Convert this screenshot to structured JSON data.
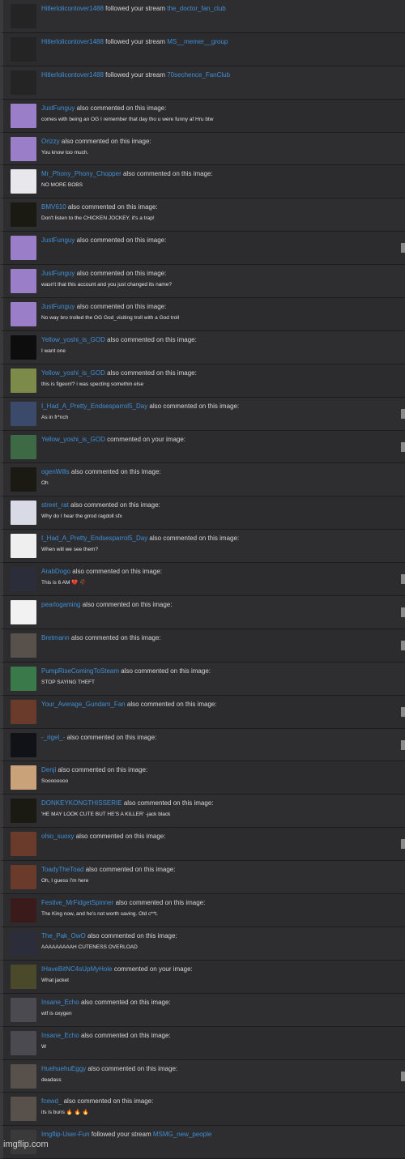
{
  "notifications": [
    {
      "user": "Hitlerlolicontover1488",
      "action": "followed your stream",
      "target": "the_doctor_fan_club",
      "message": "",
      "avatar": "#242424"
    },
    {
      "user": "Hitlerlolicontover1488",
      "action": "followed your stream",
      "target": "MS__memer__group",
      "message": "",
      "avatar": "#242424"
    },
    {
      "user": "Hitlerlolicontover1488",
      "action": "followed your stream",
      "target": "70sechence_FanClub",
      "message": "",
      "avatar": "#242424"
    },
    {
      "user": "JustFunguy",
      "action": "also commented on this image:",
      "target": "",
      "message": "comes with being an OG I remember that day tho u were funny af Hru btw",
      "avatar": "#9a7fc8"
    },
    {
      "user": "Orizzy",
      "action": "also commented on this image:",
      "target": "",
      "message": "You know too much.",
      "avatar": "#9a7fc8"
    },
    {
      "user": "Mr_Phony_Phony_Chopper",
      "action": "also commented on this image:",
      "target": "",
      "message": "NO MORE BOBS",
      "avatar": "#e8e8ec"
    },
    {
      "user": "BMV610",
      "action": "also commented on this image:",
      "target": "",
      "message": "Don't listen to the CHICKEN JOCKEY, it's a trap!",
      "avatar": "#1a1a12"
    },
    {
      "user": "JustFunguy",
      "action": "also commented on this image:",
      "target": "",
      "message": "",
      "avatar": "#9a7fc8"
    },
    {
      "user": "JustFunguy",
      "action": "also commented on this image:",
      "target": "",
      "message": "wasn't that this account and you just changed its name?",
      "avatar": "#9a7fc8"
    },
    {
      "user": "JustFunguy",
      "action": "also commented on this image:",
      "target": "",
      "message": "No way bro trolled the OG God_visiting troll with a God troll",
      "avatar": "#9a7fc8"
    },
    {
      "user": "Yellow_yoshi_is_GOD",
      "action": "also commented on this image:",
      "target": "",
      "message": "I want one",
      "avatar": "#0d0d0d"
    },
    {
      "user": "Yellow_yoshi_is_GOD",
      "action": "also commented on this image:",
      "target": "",
      "message": "this is figeon!? i was specting somethin else",
      "avatar": "#7c8a4a"
    },
    {
      "user": "I_Had_A_Pretty_Endsesparrol5_Day",
      "action": "also commented on this image:",
      "target": "",
      "message": "As in fr*nch",
      "avatar": "#3b4a6a"
    },
    {
      "user": "Yellow_yoshi_is_GOD",
      "action": "commented on your image:",
      "target": "",
      "message": "",
      "avatar": "#3d6a44"
    },
    {
      "user": "ogenWills",
      "action": "also commented on this image:",
      "target": "",
      "message": "Oh",
      "avatar": "#1a1a12"
    },
    {
      "user": "street_rat",
      "action": "also commented on this image:",
      "target": "",
      "message": "Why do I hear the grrod ragdoll sfx",
      "avatar": "#d8dbe6"
    },
    {
      "user": "I_Had_A_Pretty_Endsesparrol5_Day",
      "action": "also commented on this image:",
      "target": "",
      "message": "When will we see them?",
      "avatar": "#efefef"
    },
    {
      "user": "ArabDogo",
      "action": "also commented on this image:",
      "target": "",
      "message": "This is 6 AM 💔 🥀",
      "avatar": "#2b2d3a"
    },
    {
      "user": "pearlogaming",
      "action": "also commented on this image:",
      "target": "",
      "message": "",
      "avatar": "#f2f2f2"
    },
    {
      "user": "Bretmann",
      "action": "also commented on this image:",
      "target": "",
      "message": "",
      "avatar": "#58504a"
    },
    {
      "user": "PumpRiseComingToSteam",
      "action": "also commented on this image:",
      "target": "",
      "message": "STOP SAYING THEFT",
      "avatar": "#3a7a4a"
    },
    {
      "user": "Your_Average_Gundam_Fan",
      "action": "also commented on this image:",
      "target": "",
      "message": "",
      "avatar": "#6a3a2a"
    },
    {
      "user": "-_rigel_-",
      "action": "also commented on this image:",
      "target": "",
      "message": "",
      "avatar": "#111118"
    },
    {
      "user": "Denji",
      "action": "also commented on this image:",
      "target": "",
      "message": "Soooooooo",
      "avatar": "#c9a27a"
    },
    {
      "user": "DONKEYKONGTHISSERIE",
      "action": "also commented on this image:",
      "target": "",
      "message": "'HE MAY LOOK CUTE BUT HE'S A KILLER' -jack black",
      "avatar": "#1a1a12"
    },
    {
      "user": "ohio_suoxy",
      "action": "also commented on this image:",
      "target": "",
      "message": "",
      "avatar": "#6a3a2a"
    },
    {
      "user": "ToadyTheToad",
      "action": "also commented on this image:",
      "target": "",
      "message": "Oh, I guess I'm here",
      "avatar": "#6a3a2a"
    },
    {
      "user": "Festive_MrFidgetSpinner",
      "action": "also commented on this image:",
      "target": "",
      "message": "The King now, and he's not worth saving. Old c**t.",
      "avatar": "#3a1a1a"
    },
    {
      "user": "The_Pak_OwO",
      "action": "also commented on this image:",
      "target": "",
      "message": "AAAAAAAAAH CUTENESS OVERLOAD",
      "avatar": "#2b2d3a"
    },
    {
      "user": "IHaveBitNC4sUpMyHole",
      "action": "commented on your image:",
      "target": "",
      "message": "What jacket",
      "avatar": "#4a4a2a"
    },
    {
      "user": "Insane_Echo",
      "action": "also commented on this image:",
      "target": "",
      "message": "wtf is oxygen",
      "avatar": "#4a4a50"
    },
    {
      "user": "Insane_Echo",
      "action": "also commented on this image:",
      "target": "",
      "message": "W",
      "avatar": "#4a4a50"
    },
    {
      "user": "HuehuehuEggy",
      "action": "also commented on this image:",
      "target": "",
      "message": "deadass",
      "avatar": "#58504a"
    },
    {
      "user": "fcewd_",
      "action": "also commented on this image:",
      "target": "",
      "message": "its is buns 🔥 🔥 🔥",
      "avatar": "#58504a"
    },
    {
      "user": "Imgflip-User-Fun",
      "action": "followed your stream",
      "target": "MSMG_new_people",
      "message": "",
      "avatar": "#3a3a3a"
    }
  ],
  "watermark": "imgflip.com"
}
